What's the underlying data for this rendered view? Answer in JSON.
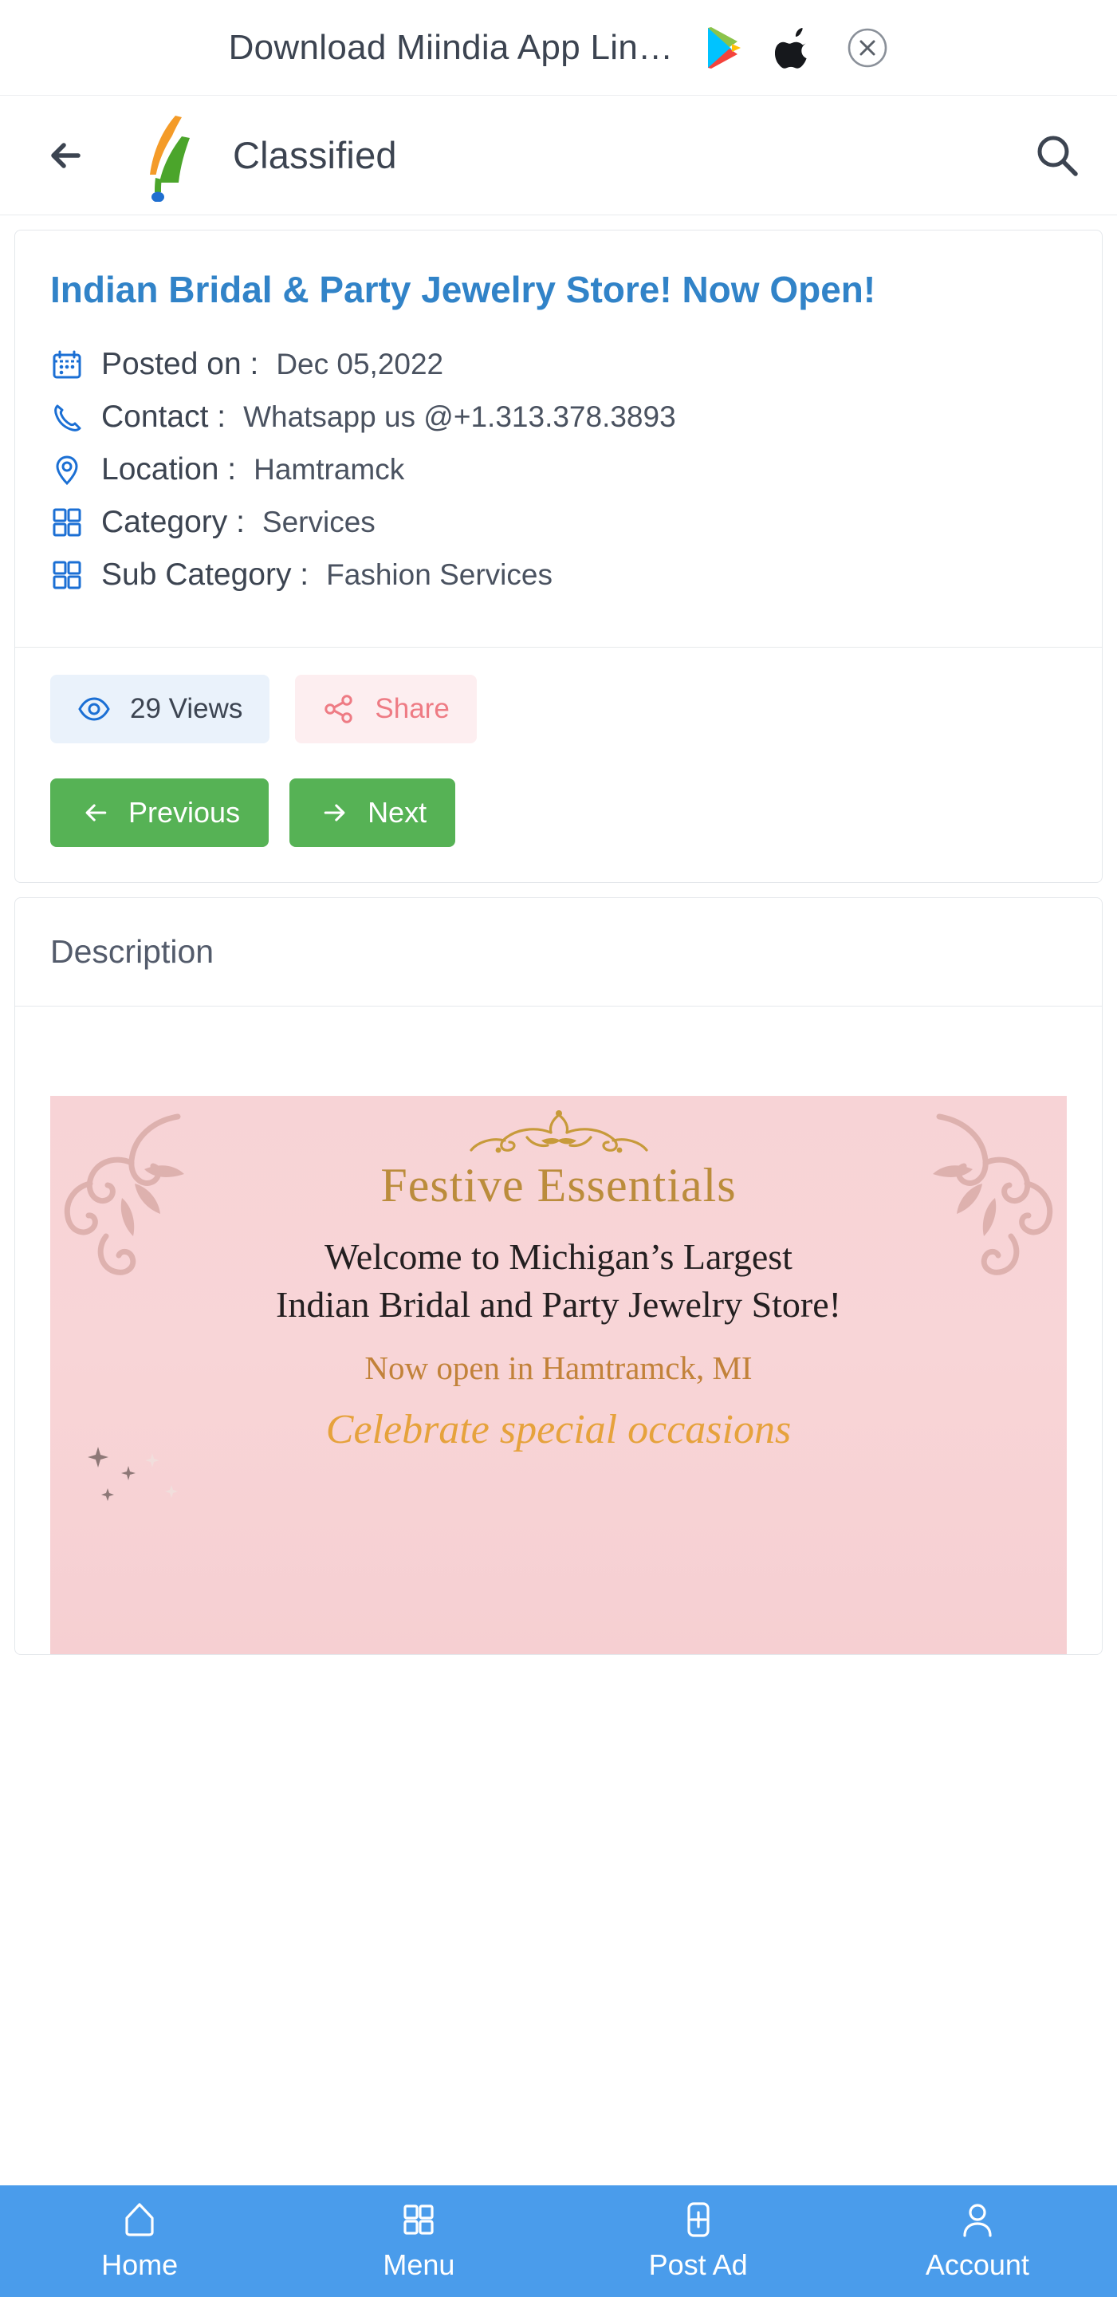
{
  "app_banner": {
    "title": "Download Miindia App Lin…",
    "google_play_icon": "google-play-icon",
    "apple_icon": "apple-icon",
    "close_icon": "close-circle-icon"
  },
  "header": {
    "back_icon": "back-arrow-icon",
    "logo": "india-flag-logo",
    "title": "Classified",
    "search_icon": "search-icon"
  },
  "listing": {
    "title": "Indian Bridal & Party Jewelry Store! Now Open!",
    "meta": [
      {
        "icon": "calendar-icon",
        "label": "Posted on :",
        "value": "Dec 05,2022"
      },
      {
        "icon": "phone-icon",
        "label": "Contact :",
        "value": "Whatsapp us @+1.313.378.3893"
      },
      {
        "icon": "location-icon",
        "label": "Location :",
        "value": "Hamtramck"
      },
      {
        "icon": "grid-icon",
        "label": "Category :",
        "value": "Services"
      },
      {
        "icon": "grid-icon",
        "label": "Sub Category :",
        "value": "Fashion Services"
      }
    ],
    "views_label": "29 Views",
    "views_icon": "eye-icon",
    "share_label": "Share",
    "share_icon": "share-icon",
    "previous_label": "Previous",
    "next_label": "Next",
    "previous_icon": "arrow-left-icon",
    "next_icon": "arrow-right-icon"
  },
  "description": {
    "header": "Description",
    "flyer": {
      "title": "Festive Essentials",
      "line1": "Welcome to Michigan’s Largest",
      "line2": "Indian Bridal and Party Jewelry Store!",
      "subtitle": "Now open in Hamtramck, MI",
      "script": "Celebrate special occasions"
    }
  },
  "bottom_nav": [
    {
      "icon": "home-icon",
      "label": "Home"
    },
    {
      "icon": "grid-icon",
      "label": "Menu"
    },
    {
      "icon": "post-ad-icon",
      "label": "Post Ad"
    },
    {
      "icon": "person-icon",
      "label": "Account"
    }
  ],
  "colors": {
    "link_blue": "#3183c8",
    "accent_blue": "#1b6fd4",
    "nav_blue": "#4a9ceb",
    "green_button": "#56b255",
    "share_pink_bg": "#fdeef0",
    "share_pink_fg": "#ee7b84",
    "views_bg": "#eaf2fb",
    "flyer_bg": "#f7d3d6",
    "flyer_gold": "#bb8c3c",
    "text_dark": "#3c4451"
  }
}
